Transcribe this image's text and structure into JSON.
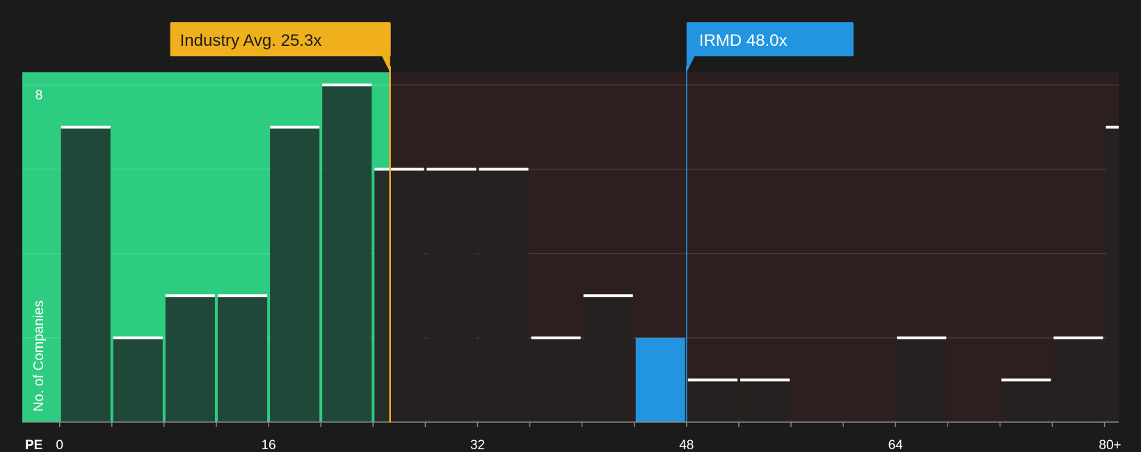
{
  "colors": {
    "background": "#1b1b1b",
    "below_region": "#2ecc80",
    "above_region": "#2d1e1f",
    "bar_in_green": "#1f3d33",
    "bar_in_dark": "#252222",
    "highlight_bar": "#2394e0",
    "bar_cap": "#ffffff",
    "industry_color": "#f0b01c",
    "company_color": "#2394e0",
    "label_text": "#ffffff"
  },
  "chart_data": {
    "type": "bar",
    "x_unit_label": "PE",
    "ylabel": "No. of Companies",
    "y_tick_labels": [
      {
        "value": 8,
        "label": "8"
      }
    ],
    "ylim": [
      0,
      8.3
    ],
    "xlim": [
      -2.86,
      81.09
    ],
    "gridlines": [
      2,
      4,
      6,
      8
    ],
    "x_tick_labels": [
      {
        "value": 0,
        "label": "0"
      },
      {
        "value": 16,
        "label": "16"
      },
      {
        "value": 32,
        "label": "32"
      },
      {
        "value": 48,
        "label": "48"
      },
      {
        "value": 64,
        "label": "64"
      },
      {
        "value": 80,
        "label": "80+"
      }
    ],
    "bin_width": 4,
    "bins": [
      {
        "start": 0,
        "value": 7
      },
      {
        "start": 4,
        "value": 2
      },
      {
        "start": 8,
        "value": 3
      },
      {
        "start": 12,
        "value": 3
      },
      {
        "start": 16,
        "value": 7
      },
      {
        "start": 20,
        "value": 8
      },
      {
        "start": 24,
        "value": 6
      },
      {
        "start": 28,
        "value": 6
      },
      {
        "start": 32,
        "value": 6
      },
      {
        "start": 36,
        "value": 2
      },
      {
        "start": 40,
        "value": 3
      },
      {
        "start": 44,
        "value": 2,
        "highlight": true
      },
      {
        "start": 48,
        "value": 1
      },
      {
        "start": 52,
        "value": 1
      },
      {
        "start": 56,
        "value": 0
      },
      {
        "start": 60,
        "value": 0
      },
      {
        "start": 64,
        "value": 2
      },
      {
        "start": 68,
        "value": 0
      },
      {
        "start": 72,
        "value": 1
      },
      {
        "start": 76,
        "value": 2
      },
      {
        "start": 80,
        "value": 7
      }
    ],
    "industry_avg": {
      "label": "Industry Avg. 25.3x",
      "value": 25.3
    },
    "company": {
      "label": "IRMD 48.0x",
      "value": 48.0
    }
  }
}
